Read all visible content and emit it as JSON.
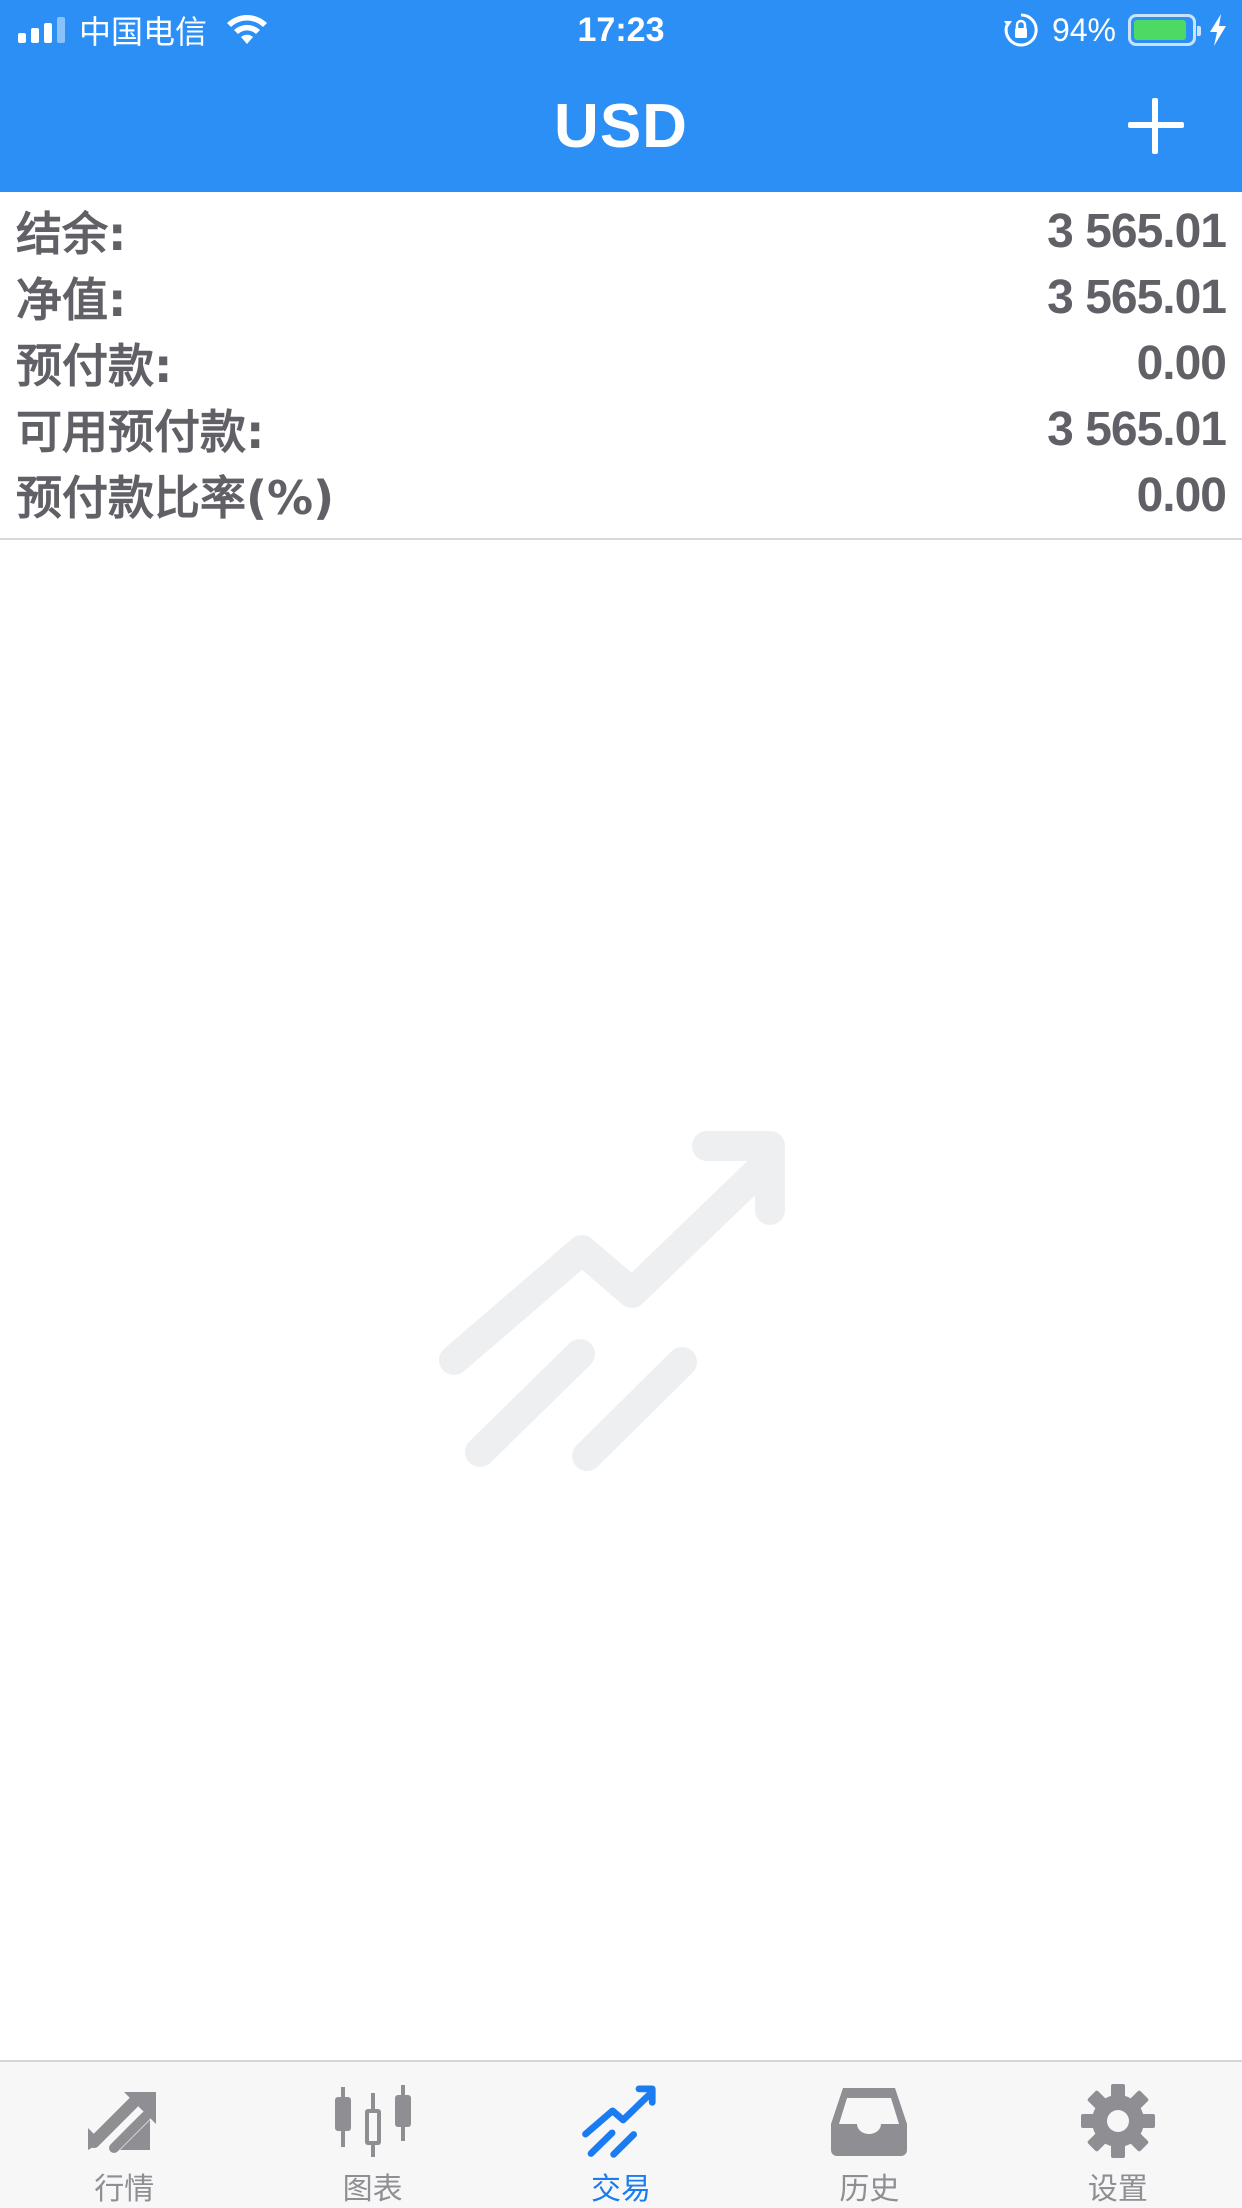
{
  "status_bar": {
    "carrier": "中国电信",
    "time": "17:23",
    "battery_percent": "94%",
    "battery_level": 0.94,
    "signal_bars": 4,
    "signal_strength": 3
  },
  "header": {
    "title": "USD",
    "add_icon": "plus-icon"
  },
  "account": {
    "rows": [
      {
        "label": "结余:",
        "value": "3 565.01"
      },
      {
        "label": "净值:",
        "value": "3 565.01"
      },
      {
        "label": "预付款:",
        "value": "0.00"
      },
      {
        "label": "可用预付款:",
        "value": "3 565.01"
      },
      {
        "label": "预付款比率(%)",
        "value": "0.00"
      }
    ]
  },
  "empty_state": {
    "icon": "trade-arrow-icon"
  },
  "tabbar": {
    "active_color": "#1a7cf0",
    "inactive_color": "#8e8e93",
    "items": [
      {
        "label": "行情",
        "icon": "quotes-icon"
      },
      {
        "label": "图表",
        "icon": "candlestick-chart-icon"
      },
      {
        "label": "交易",
        "icon": "trade-icon",
        "active": true
      },
      {
        "label": "历史",
        "icon": "inbox-history-icon"
      },
      {
        "label": "设置",
        "icon": "gear-icon"
      }
    ]
  },
  "colors": {
    "header_bg": "#2b8ff5",
    "text": "#606066",
    "battery_fill": "#4cd964"
  }
}
